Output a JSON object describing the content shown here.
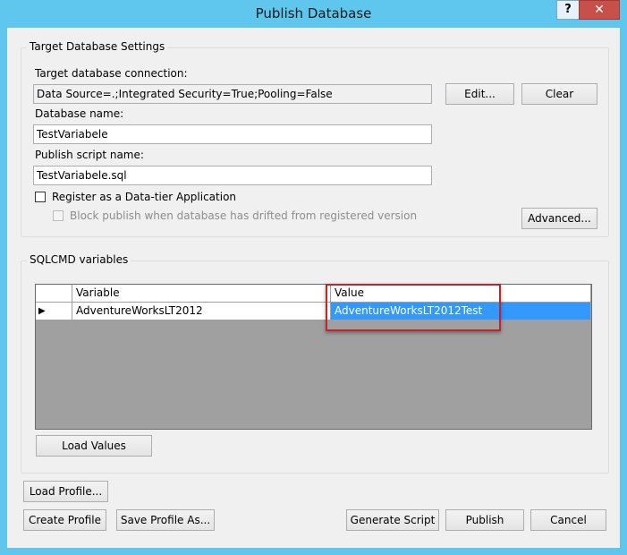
{
  "window": {
    "title": "Publish Database",
    "help_label": "?",
    "close_label": "✕"
  },
  "target": {
    "group_title": "Target Database Settings",
    "connection_label": "Target database connection:",
    "connection_value": "Data Source=.;Integrated Security=True;Pooling=False",
    "edit_button": "Edit...",
    "clear_button": "Clear",
    "db_name_label": "Database name:",
    "db_name_value": "TestVariabele",
    "script_name_label": "Publish script name:",
    "script_name_value": "TestVariabele.sql",
    "register_label": "Register as a Data-tier Application",
    "block_label": "Block publish when database has drifted from registered version",
    "advanced_button": "Advanced..."
  },
  "sqlcmd": {
    "group_title": "SQLCMD variables",
    "columns": [
      "Variable",
      "Value"
    ],
    "rows": [
      {
        "variable": "AdventureWorksLT2012",
        "value": "AdventureWorksLT2012Test"
      }
    ],
    "row_indicator": "▶",
    "load_values_button": "Load Values"
  },
  "footer": {
    "load_profile": "Load Profile...",
    "create_profile": "Create Profile",
    "save_profile_as": "Save Profile As...",
    "generate_script": "Generate Script",
    "publish": "Publish",
    "cancel": "Cancel"
  },
  "colors": {
    "titlebar": "#5fc7ee",
    "selection": "#3399ff",
    "highlight_box": "#c0242c",
    "close_button": "#c7504a"
  }
}
